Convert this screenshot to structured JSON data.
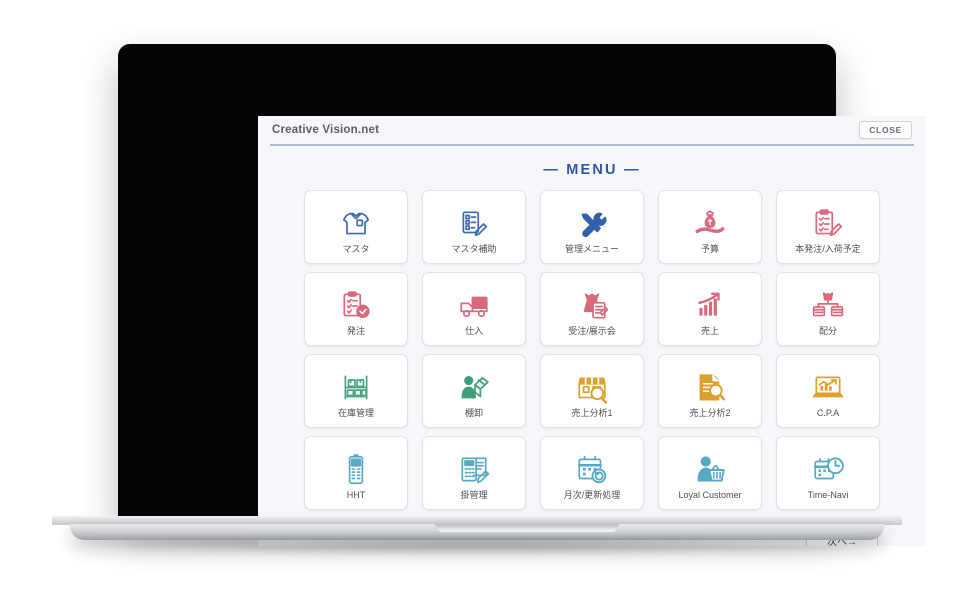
{
  "window": {
    "title": "Creative Vision.net",
    "close_label": "CLOSE"
  },
  "heading": "— MENU —",
  "colors": {
    "blue": "#4169b2",
    "pink": "#d9697c",
    "green": "#4aa581",
    "orange": "#dca02f",
    "teal": "#5aa9c4",
    "heading_blue": "#2f55a4",
    "screen_bg": "#f6f7fb",
    "card_bg": "#ffffff"
  },
  "menu": {
    "items": [
      {
        "label": "マスタ",
        "icon": "shirt-icon",
        "color": "#4169b2"
      },
      {
        "label": "マスタ補助",
        "icon": "checklist-pencil-icon",
        "color": "#4169b2"
      },
      {
        "label": "管理メニュー",
        "icon": "tools-icon",
        "color": "#2f5fae"
      },
      {
        "label": "予算",
        "icon": "money-bag-hand-icon",
        "color": "#d9697c"
      },
      {
        "label": "本発注/入荷予定",
        "icon": "clipboard-pencil-icon",
        "color": "#d9697c"
      },
      {
        "label": "発注",
        "icon": "clipboard-check-icon",
        "color": "#d9697c"
      },
      {
        "label": "仕入",
        "icon": "truck-icon",
        "color": "#d9697c"
      },
      {
        "label": "受注/展示会",
        "icon": "dress-document-icon",
        "color": "#d9697c"
      },
      {
        "label": "売上",
        "icon": "bar-chart-arrow-icon",
        "color": "#d9697c"
      },
      {
        "label": "配分",
        "icon": "distribution-icon",
        "color": "#d9697c"
      },
      {
        "label": "在庫管理",
        "icon": "shelf-boxes-icon",
        "color": "#4aa581"
      },
      {
        "label": "棚卸",
        "icon": "person-box-icon",
        "color": "#3f9e78"
      },
      {
        "label": "売上分析1",
        "icon": "shop-search-icon",
        "color": "#dca02f"
      },
      {
        "label": "売上分析2",
        "icon": "document-search-icon",
        "color": "#dca02f"
      },
      {
        "label": "C.P.A",
        "icon": "laptop-chart-icon",
        "color": "#dca02f"
      },
      {
        "label": "HHT",
        "icon": "handheld-terminal-icon",
        "color": "#5aa9c4"
      },
      {
        "label": "掛管理",
        "icon": "calculator-pencil-icon",
        "color": "#5aa9c4"
      },
      {
        "label": "月次/更新処理",
        "icon": "calendar-refresh-icon",
        "color": "#5aa9c4"
      },
      {
        "label": "Loyal Customer",
        "icon": "customer-basket-icon",
        "color": "#5aa9c4"
      },
      {
        "label": "Time-Navi",
        "icon": "calendar-clock-icon",
        "color": "#5aa9c4"
      }
    ]
  },
  "footer": {
    "next_label": "次へ→"
  }
}
